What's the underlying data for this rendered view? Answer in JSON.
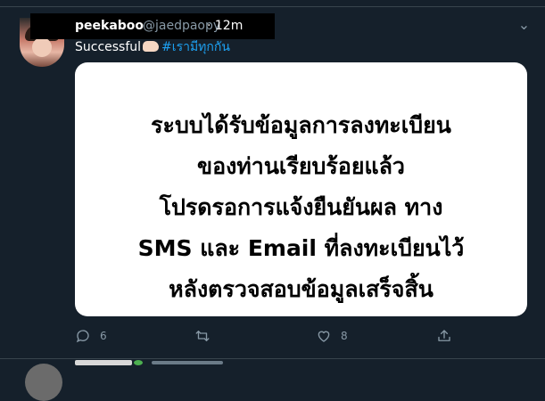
{
  "tweet": {
    "display_name": "peekaboo",
    "handle": "@jaedpaopy",
    "time": "· 12m",
    "text_prefix": "Successful",
    "hashtag": "#เรามีทุกกัน",
    "card_lines": [
      "ระบบได้รับข้อมูลการลงทะเบียน",
      "ของท่านเรียบร้อยแล้ว",
      "โปรดรอการแจ้งยืนยันผล ทาง",
      "SMS และ Email ที่ลงทะเบียนไว้",
      "หลังตรวจสอบข้อมูลเสร็จสิ้น"
    ],
    "actions": {
      "reply_count": "6",
      "retweet_count": "",
      "like_count": "8"
    }
  },
  "icons": {
    "reply": "reply-icon",
    "retweet": "retweet-icon",
    "like": "heart-icon",
    "share": "share-icon",
    "more": "more-options-icon"
  },
  "colors": {
    "background": "#15202b",
    "secondary_text": "#8899a6",
    "hashtag": "#1da1f2",
    "divider": "#38444d"
  }
}
